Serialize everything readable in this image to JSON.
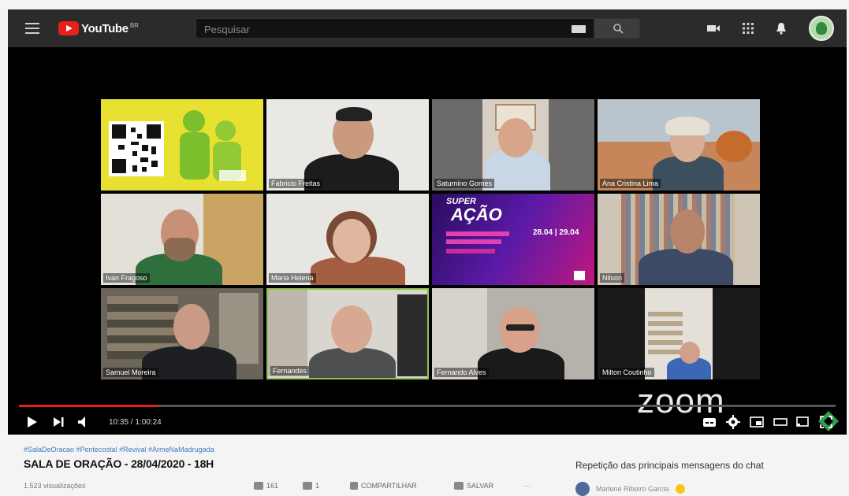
{
  "header": {
    "logo_text": "YouTube",
    "logo_region": "BR",
    "search_placeholder": "Pesquisar",
    "icons": [
      "menu-icon",
      "keyboard-icon",
      "search-icon",
      "create-video-icon",
      "apps-icon",
      "notifications-icon",
      "avatar"
    ]
  },
  "participants": [
    {
      "name": ""
    },
    {
      "name": "Fabricio Freitas"
    },
    {
      "name": "Saturnino Gomes"
    },
    {
      "name": "Ana Cristina Lima"
    },
    {
      "name": "Ivan Fragoso"
    },
    {
      "name": "Maria Helena"
    },
    {
      "name": ""
    },
    {
      "name": "Nilson"
    },
    {
      "name": "Samuel Moreira"
    },
    {
      "name": "Fernandes"
    },
    {
      "name": "Fernando Alves"
    },
    {
      "name": "Milton Coutinho"
    }
  ],
  "promo": {
    "line1": "SUPER",
    "line2": "AÇÃO",
    "dates": "28.04 | 29.04"
  },
  "watermark": "zoom",
  "player": {
    "time": "10:35 / 1:00:24",
    "progress": 0.17,
    "colors": {
      "accent": "#e62117",
      "highlight": "#8bc34a"
    }
  },
  "video": {
    "hashtags": "#SalaDeOracao #Pentecostal #Revival #ArmeNaMadrugada",
    "title": "SALA DE ORAÇÃO - 28/04/2020 - 18H",
    "views": "1.523 visualizações",
    "likes": "161",
    "dislikes": "1",
    "share_label": "COMPARTILHAR",
    "save_label": "SALVAR",
    "more": "···"
  },
  "chat": {
    "header": "Repetição das principais mensagens do chat",
    "first_user": "Marlene Ribeiro Garcia"
  }
}
